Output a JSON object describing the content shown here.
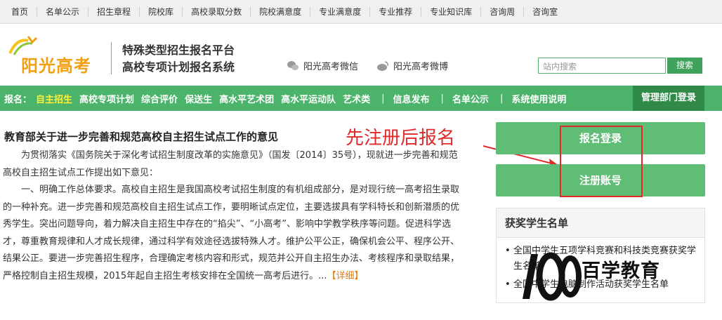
{
  "top_nav": [
    "首页",
    "名单公示",
    "招生章程",
    "院校库",
    "高校录取分数",
    "院校满意度",
    "专业满意度",
    "专业推荐",
    "专业知识库",
    "咨询周",
    "咨询室"
  ],
  "header": {
    "logo_text": "阳光高考",
    "platform_line1": "特殊类型招生报名平台",
    "platform_line2": "高校专项计划报名系统",
    "wechat_label": "阳光高考微信",
    "weibo_label": "阳光高考微博",
    "search_placeholder": "站内搜索",
    "search_button": "搜索"
  },
  "green_nav": {
    "label": "报名：",
    "items": [
      "自主招生",
      "高校专项计划",
      "综合评价",
      "保送生",
      "高水平艺术团",
      "高水平运动队",
      "艺术类"
    ],
    "sep": "|",
    "links": [
      "信息发布",
      "名单公示",
      "系统使用说明"
    ],
    "manager_login": "管理部门登录"
  },
  "article": {
    "title": "教育部关于进一步完善和规范高校自主招生试点工作的意见",
    "para1": "为贯彻落实《国务院关于深化考试招生制度改革的实施意见》（国发〔2014〕35号），现就进一步完善和规范高校自主招生试点工作提出如下意见：",
    "para2": "一、明确工作总体要求。高校自主招生是我国高校考试招生制度的有机组成部分，是对现行统一高考招生录取的一种补充。进一步完善和规范高校自主招生试点工作，要明晰试点定位，主要选拔具有学科特长和创新潜质的优秀学生。突出问题导向，着力解决自主招生中存在的“掐尖”、“小高考”、影响中学教学秩序等问题。促进科学选才，尊重教育规律和人才成长规律，通过科学有效途径选拔特殊人才。维护公平公正，确保机会公平、程序公开、结果公正。要进一步完善招生程序，合理确定考核内容和形式，规范并公开自主招生办法、考核程序和录取结果，严格控制自主招生规模，2015年起自主招生考核安排在全国统一高考后进行。...",
    "more": "【详细】"
  },
  "annotation": "先注册后报名",
  "buttons": {
    "login": "报名登录",
    "register": "注册账号"
  },
  "award": {
    "title": "获奖学生名单",
    "items": [
      "全国中学生五项学科竞赛和科技类竞赛获奖学生名单",
      "全国中学生电脑制作活动获奖学生名单"
    ]
  },
  "watermark": "百学教育",
  "colors": {
    "green": "#4cb36a",
    "dark_green": "#2f8a47",
    "button_green": "#5fbd76",
    "annotation_red": "#e02a2a",
    "logo_orange": "#f0a010"
  }
}
